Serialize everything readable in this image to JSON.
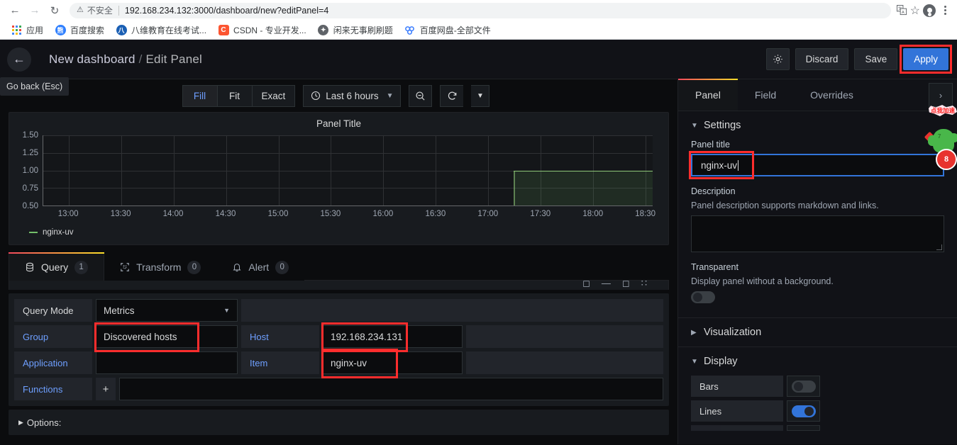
{
  "browser": {
    "back_icon": "back-arrow-icon",
    "forward_icon": "forward-arrow-icon",
    "reload_icon": "reload-icon",
    "security_warning": "不安全",
    "warning_icon": "warning-triangle-icon",
    "url": "192.168.234.132:3000/dashboard/new?editPanel=4",
    "translate_icon": "translate-icon",
    "star_icon": "bookmark-star-icon",
    "profile_icon": "profile-avatar-icon",
    "menu_icon": "kebab-menu-icon",
    "bookmarks": [
      {
        "label": "应用",
        "icon": "apps-grid-icon",
        "color": "#4285f4"
      },
      {
        "label": "百度搜索",
        "icon": "baidu-icon",
        "color": "#2e7fff",
        "glyph": "熊"
      },
      {
        "label": "八维教育在线考试...",
        "icon": "bawei-icon",
        "color": "#1a5fb4",
        "glyph": "八"
      },
      {
        "label": "CSDN - 专业开发...",
        "icon": "csdn-icon",
        "color": "#fc5531",
        "glyph": "C"
      },
      {
        "label": "闲来无事刷刷题",
        "icon": "quiz-icon",
        "color": "#5f6368",
        "glyph": "✦"
      },
      {
        "label": "百度网盘-全部文件",
        "icon": "baidu-pan-icon",
        "color": "#2e7fff",
        "glyph": "∞"
      }
    ]
  },
  "grafana": {
    "back_icon": "back-arrow-icon",
    "back_tooltip": "Go back (Esc)",
    "dashboard_name": "New dashboard",
    "separator": "/",
    "page_name": "Edit Panel",
    "settings_icon": "gear-icon",
    "discard_label": "Discard",
    "save_label": "Save",
    "apply_label": "Apply",
    "apply_accent": "#3274d9",
    "highlight_color": "#ff2d2d"
  },
  "toolbar": {
    "fit_modes": [
      {
        "label": "Fill",
        "active": true
      },
      {
        "label": "Fit",
        "active": false
      },
      {
        "label": "Exact",
        "active": false
      }
    ],
    "clock_icon": "clock-icon",
    "time_range": "Last 6 hours",
    "chevron_icon": "chevron-down-icon",
    "zoom_out_icon": "zoom-out-icon",
    "refresh_icon": "refresh-icon",
    "refresh_chevron_icon": "chevron-down-icon"
  },
  "chart_data": {
    "type": "area",
    "title": "Panel Title",
    "xlabel": "",
    "ylabel": "",
    "ylim": [
      0.5,
      1.5
    ],
    "yticks": [
      1.5,
      1.25,
      1.0,
      0.75,
      0.5
    ],
    "ytick_labels": [
      "1.50",
      "1.25",
      "1.00",
      "0.75",
      "0.50"
    ],
    "xticks": [
      "13:00",
      "13:30",
      "14:00",
      "14:30",
      "15:00",
      "15:30",
      "16:00",
      "16:30",
      "17:00",
      "17:30",
      "18:00",
      "18:30"
    ],
    "grid": true,
    "legend_position": "bottom-left",
    "series": [
      {
        "name": "nginx-uv",
        "color": "#73bf69",
        "fill": true,
        "start_x": "17:22",
        "end_x": "18:50",
        "value": 1.0,
        "points": [
          {
            "x": "17:22",
            "y": 1.0
          },
          {
            "x": "18:50",
            "y": 1.0
          }
        ]
      }
    ]
  },
  "query_tabs": [
    {
      "label": "Query",
      "count": "1",
      "icon": "database-icon",
      "active": true
    },
    {
      "label": "Transform",
      "count": "0",
      "icon": "transform-icon",
      "active": false
    },
    {
      "label": "Alert",
      "count": "0",
      "icon": "bell-icon",
      "active": false
    }
  ],
  "query_editor": {
    "rows": [
      {
        "label": "Query Mode",
        "label_link": false,
        "value": "Metrics",
        "select": true,
        "right_label": "",
        "right_value": "",
        "highlight_left": false,
        "highlight_right": false
      },
      {
        "label": "Group",
        "label_link": true,
        "value": "Discovered hosts",
        "select": false,
        "right_label": "Host",
        "right_value": "192.168.234.131",
        "highlight_left": true,
        "highlight_right": true
      },
      {
        "label": "Application",
        "label_link": true,
        "value": "",
        "select": false,
        "right_label": "Item",
        "right_value": "nginx-uv",
        "highlight_left": false,
        "highlight_right": true
      }
    ],
    "functions_label": "Functions",
    "add_icon": "plus-icon",
    "options_label": "Options:",
    "options_caret_icon": "caret-right-icon"
  },
  "options_pane": {
    "tabs": [
      {
        "label": "Panel",
        "active": true
      },
      {
        "label": "Field",
        "active": false
      },
      {
        "label": "Overrides",
        "active": false
      }
    ],
    "collapse_icon": "chevron-right-icon",
    "sections": {
      "settings": {
        "title": "Settings",
        "expanded": true,
        "chevron_icon": "chevron-down-icon",
        "panel_title_label": "Panel title",
        "panel_title_value": "nginx-uv",
        "description_label": "Description",
        "description_help": "Panel description supports markdown and links.",
        "description_value": "",
        "transparent_label": "Transparent",
        "transparent_help": "Display panel without a background.",
        "transparent_on": false
      },
      "visualization": {
        "title": "Visualization",
        "expanded": false,
        "chevron_icon": "chevron-right-icon"
      },
      "display": {
        "title": "Display",
        "expanded": true,
        "chevron_icon": "chevron-down-icon",
        "toggles": [
          {
            "label": "Bars",
            "on": false
          },
          {
            "label": "Lines",
            "on": true
          }
        ]
      }
    }
  },
  "promo_widget": {
    "bubble_text": "点我加速",
    "badge_text": "8",
    "cactus_number": "7",
    "icon": "cactus-mascot-icon"
  }
}
